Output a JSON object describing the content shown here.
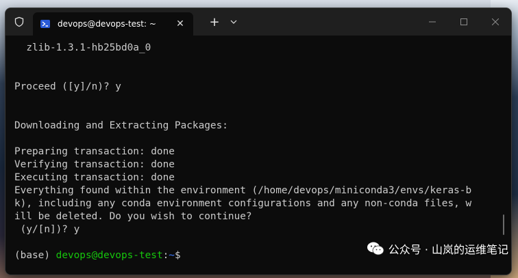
{
  "window": {
    "tab_title": "devops@devops-test: ~",
    "tab_close": "✕",
    "new_tab": "+",
    "dropdown": "⌄"
  },
  "terminal": {
    "lines": [
      "  zlib-1.3.1-hb25bd0a_0",
      "",
      "",
      "Proceed ([y]/n)? y",
      "",
      "",
      "Downloading and Extracting Packages:",
      "",
      "Preparing transaction: done",
      "Verifying transaction: done",
      "Executing transaction: done",
      "Everything found within the environment (/home/devops/miniconda3/envs/keras-b",
      "k), including any conda environment configurations and any non-conda files, w",
      "ill be deleted. Do you wish to continue?",
      " (y/[n])? y",
      ""
    ],
    "prompt": {
      "env": "(base) ",
      "user": "devops@devops-test",
      "sep": ":",
      "path": "~",
      "symbol": "$"
    }
  },
  "watermark": {
    "text": "公众号 · 山岚的运维笔记"
  },
  "colors": {
    "terminal_bg": "#0c0c0c",
    "terminal_fg": "#cccccc",
    "prompt_user": "#16c60c",
    "prompt_path": "#3b78ff",
    "titlebar_bg": "#1f1f1f"
  },
  "icons": [
    "shield-icon",
    "powershell-icon",
    "close-icon",
    "plus-icon",
    "chevron-down-icon",
    "minimize-icon",
    "maximize-icon",
    "window-close-icon",
    "wechat-icon"
  ]
}
